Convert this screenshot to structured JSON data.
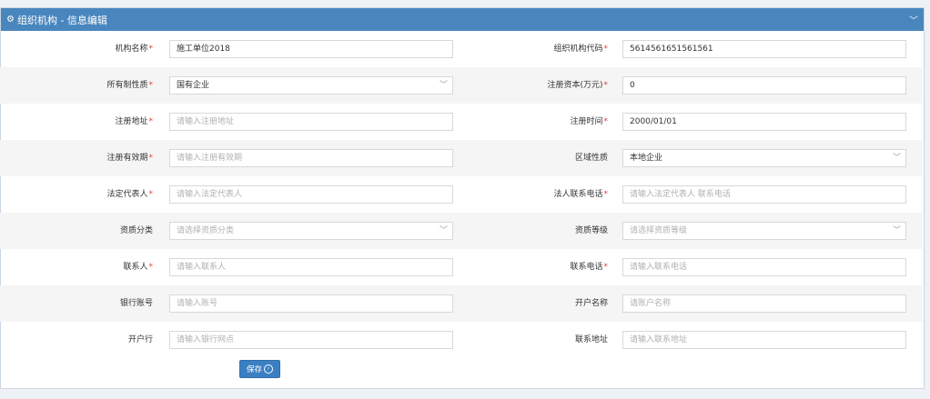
{
  "header": {
    "icon": "cogs-icon",
    "title": "组织机构 - 信息编辑",
    "collapse_icon": "chevron-down-icon"
  },
  "form": {
    "org_name": {
      "label": "机构名称",
      "value": "施工单位2018"
    },
    "org_code": {
      "label": "组织机构代码",
      "value": "5614561651561561"
    },
    "ownership": {
      "label": "所有制性质",
      "value": "国有企业"
    },
    "reg_capital": {
      "label": "注册资本(万元)",
      "value": "0"
    },
    "reg_address": {
      "label": "注册地址",
      "placeholder": "请输入注册地址"
    },
    "reg_time": {
      "label": "注册时间",
      "value": "2000/01/01"
    },
    "reg_validity": {
      "label": "注册有效期",
      "placeholder": "请输入注册有效期"
    },
    "region_type": {
      "label": "区域性质",
      "value": "本地企业"
    },
    "legal_rep": {
      "label": "法定代表人",
      "placeholder": "请输入法定代表人"
    },
    "legal_phone": {
      "label": "法人联系电话",
      "placeholder": "请输入法定代表人 联系电话"
    },
    "qual_category": {
      "label": "资质分类",
      "value": "请选择资质分类"
    },
    "qual_level": {
      "label": "资质等级",
      "value": "请选择资质等级"
    },
    "contact": {
      "label": "联系人",
      "placeholder": "请输入联系人"
    },
    "contact_phone": {
      "label": "联系电话",
      "placeholder": "请输入联系电话"
    },
    "bank_account": {
      "label": "银行账号",
      "placeholder": "请输入账号"
    },
    "account_name": {
      "label": "开户名称",
      "placeholder": "请账户名称"
    },
    "bank_branch": {
      "label": "开户行",
      "placeholder": "请输入银行网点"
    },
    "contact_address": {
      "label": "联系地址",
      "placeholder": "请输入联系地址"
    }
  },
  "required_mark": "*",
  "save_label": "保存",
  "save_icon": "arrow-right-circle-icon",
  "colors": {
    "header": "#4a86be",
    "required": "#e23b3b",
    "button": "#3a7fc1"
  }
}
